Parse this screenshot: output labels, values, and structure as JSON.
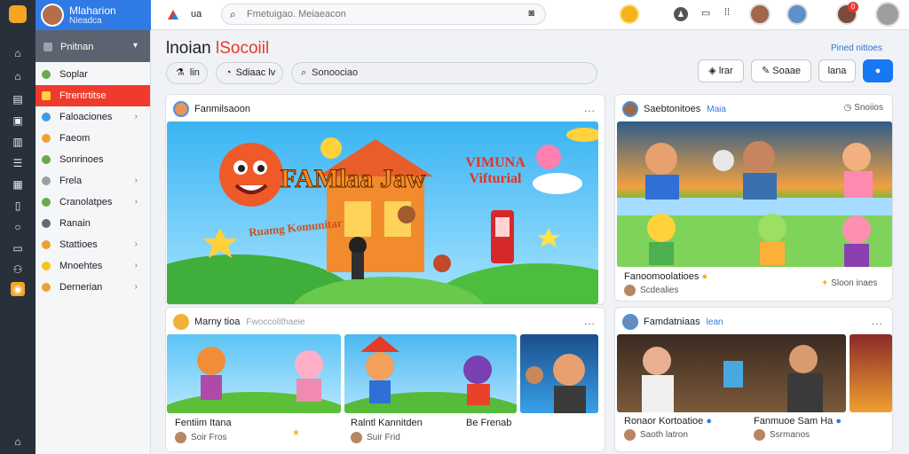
{
  "profile": {
    "name": "Mlaharion",
    "subtitle": "Nieadca"
  },
  "topbar": {
    "home_label": "ua",
    "search_placeholder": "Fmetuigao. Meiaeacon",
    "notif_count": "0"
  },
  "sidebar": {
    "header": "Pnitnan",
    "items": [
      {
        "label": "Soplar",
        "color": "#6aa84f",
        "chevron": false,
        "active": false
      },
      {
        "label": "Ftrentrtitse",
        "color": "#f5a524",
        "chevron": false,
        "active": true
      },
      {
        "label": "Faloaciones",
        "color": "#3d9be9",
        "chevron": true,
        "active": false
      },
      {
        "label": "Faeom",
        "color": "#f0a030",
        "chevron": false,
        "active": false
      },
      {
        "label": "Sonrinoes",
        "color": "#6aa84f",
        "chevron": false,
        "active": false
      },
      {
        "label": "Frela",
        "color": "#9aa0a6",
        "chevron": true,
        "active": false
      },
      {
        "label": "Cranolatpes",
        "color": "#6aa84f",
        "chevron": true,
        "active": false
      },
      {
        "label": "Ranain",
        "color": "#5f6b7a",
        "chevron": false,
        "active": false
      },
      {
        "label": "Stattioes",
        "color": "#f0a030",
        "chevron": true,
        "active": false
      },
      {
        "label": "Mnoehtes",
        "color": "#f5c518",
        "chevron": true,
        "active": false
      },
      {
        "label": "Dernerian",
        "color": "#f0a030",
        "chevron": true,
        "active": false
      }
    ]
  },
  "page": {
    "title_main": "lnoian",
    "title_accent": "lSocoiil",
    "link": "Pined nittoes"
  },
  "filters": {
    "btn1": "lin",
    "btn2": "Sdiaac lv",
    "search": "Sonoociao"
  },
  "actions": {
    "btn1": "lrar",
    "btn2": "Soaae",
    "btn3": "lana",
    "primary_icon": "bell-icon"
  },
  "main_post": {
    "author": "Fanmilsaoon",
    "more": "...",
    "banner_title": "FAMlaa Jaw",
    "banner_side": "VIMUNA Vifturial",
    "banner_sub": "Ruamg Komunitar"
  },
  "row_post": {
    "author": "Marny tioa",
    "sub": "Fwoccolithaeie",
    "more": "...",
    "thumbs": [
      {
        "title": "Fentiim Itana",
        "meta": "Soir Fros"
      },
      {
        "title": "Ralntl Kannitden",
        "meta": "Suir Frid"
      },
      {
        "title": "Be Frenab",
        "meta": ""
      }
    ]
  },
  "right_post_1": {
    "author": "Saebtonitoes",
    "sub": "Maia",
    "meta_right": "Snoiios",
    "caption": "Fanoomoolatioes",
    "caption_meta": "Scdealies",
    "side_meta": "Sloon inaes"
  },
  "right_post_2": {
    "author": "Famdatniaas",
    "sub": "lean",
    "more": "...",
    "caption_1": "Ronaor Kortoatioe",
    "meta_1": "Saoth latron",
    "caption_2": "Fanmuoe Sam Ha",
    "meta_2": "Ssrmanos"
  }
}
